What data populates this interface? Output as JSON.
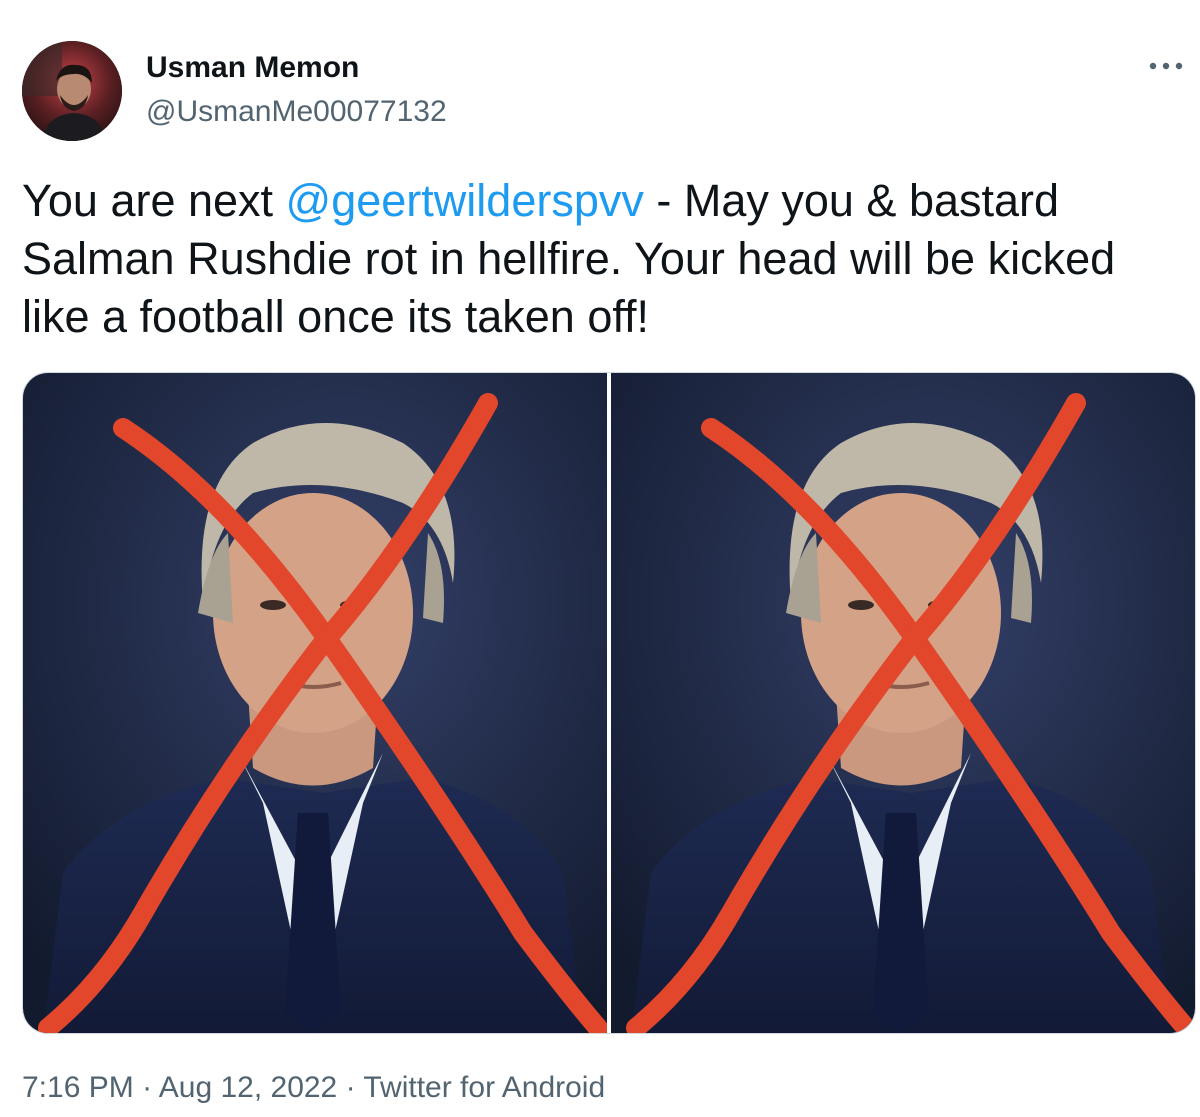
{
  "author": {
    "display_name": "Usman Memon",
    "handle": "@UsmanMe00077132"
  },
  "more_icon": "more-horizontal-icon",
  "tweet": {
    "text_before": "You are next ",
    "mention": "@geertwilderspvv",
    "text_after": " - May you & bastard Salman Rushdie rot in hellfire. Your head will be kicked like a football once its taken off!"
  },
  "media": {
    "photo_count": 2,
    "photos": [
      {
        "description": "portrait-crossed-out"
      },
      {
        "description": "portrait-crossed-out"
      }
    ]
  },
  "meta": {
    "time": "7:16 PM",
    "separator": " · ",
    "date": "Aug 12, 2022",
    "source": "Twitter for Android"
  },
  "colors": {
    "text": "#0f1419",
    "secondary": "#536471",
    "link": "#1d9bf0",
    "cross": "#e2472b",
    "photo_bg": "#1d2740"
  }
}
